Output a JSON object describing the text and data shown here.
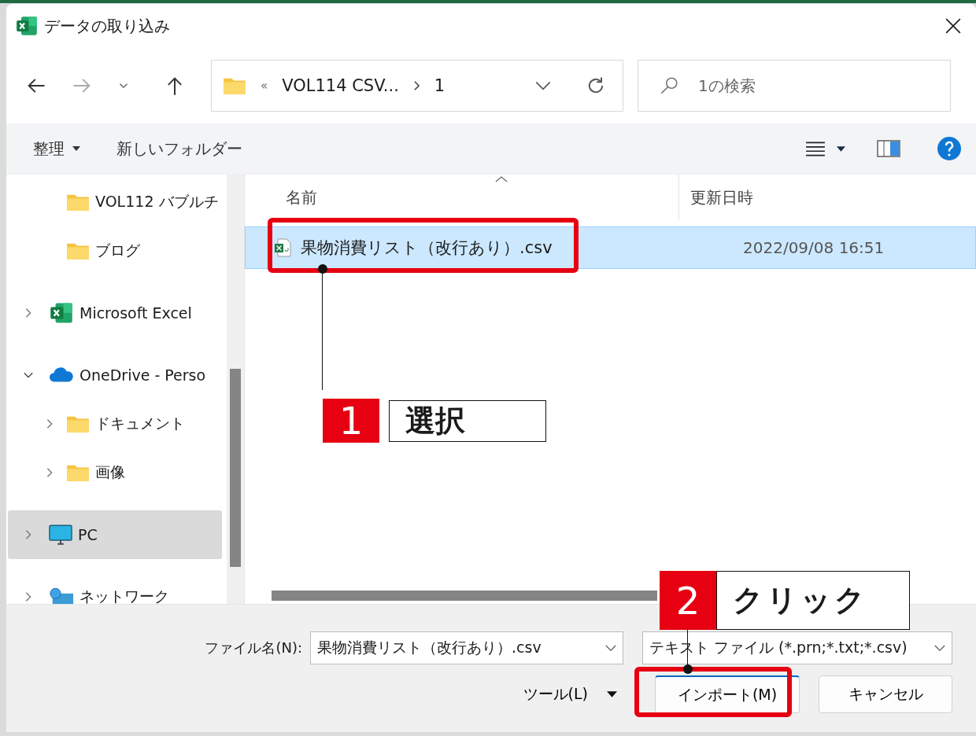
{
  "window": {
    "title": "データの取り込み"
  },
  "address": {
    "overflow": "«",
    "segments": [
      "VOL114 CSV...",
      "1"
    ]
  },
  "search": {
    "placeholder": "1の検索"
  },
  "toolbar": {
    "organize": "整理",
    "new_folder": "新しいフォルダー"
  },
  "sidebar": {
    "scrolled_children": [
      {
        "label": "VOL112 バブルチ",
        "kind": "folder",
        "selected": false
      },
      {
        "label": "ブログ",
        "kind": "folder",
        "selected": false
      }
    ],
    "items": [
      {
        "label": "Microsoft Excel",
        "kind": "excel",
        "expanded": false,
        "selected": false
      },
      {
        "label": "OneDrive - Perso",
        "kind": "cloud",
        "expanded": true,
        "selected": false,
        "children": [
          {
            "label": "ドキュメント",
            "kind": "folder",
            "expanded": false,
            "selected": false
          },
          {
            "label": "画像",
            "kind": "folder",
            "expanded": false,
            "selected": false
          }
        ]
      },
      {
        "label": "PC",
        "kind": "pc",
        "expanded": false,
        "selected": true
      },
      {
        "label": "ネットワーク",
        "kind": "network",
        "expanded": false,
        "selected": false
      }
    ]
  },
  "table": {
    "columns": [
      "名前",
      "更新日時"
    ],
    "rows": [
      {
        "name": "果物消費リスト（改行あり）.csv",
        "modified": "2022/09/08 16:51",
        "selected": true
      }
    ]
  },
  "footer": {
    "filename_label": "ファイル名(N):",
    "filename": "果物消費リスト（改行あり）.csv",
    "filetype": "テキスト ファイル (*.prn;*.txt;*.csv)",
    "tools": "ツール(L)",
    "import": "インポート(M)",
    "cancel": "キャンセル"
  },
  "callouts": [
    {
      "number": "1",
      "label": "選択"
    },
    {
      "number": "2",
      "label": "クリック"
    }
  ]
}
